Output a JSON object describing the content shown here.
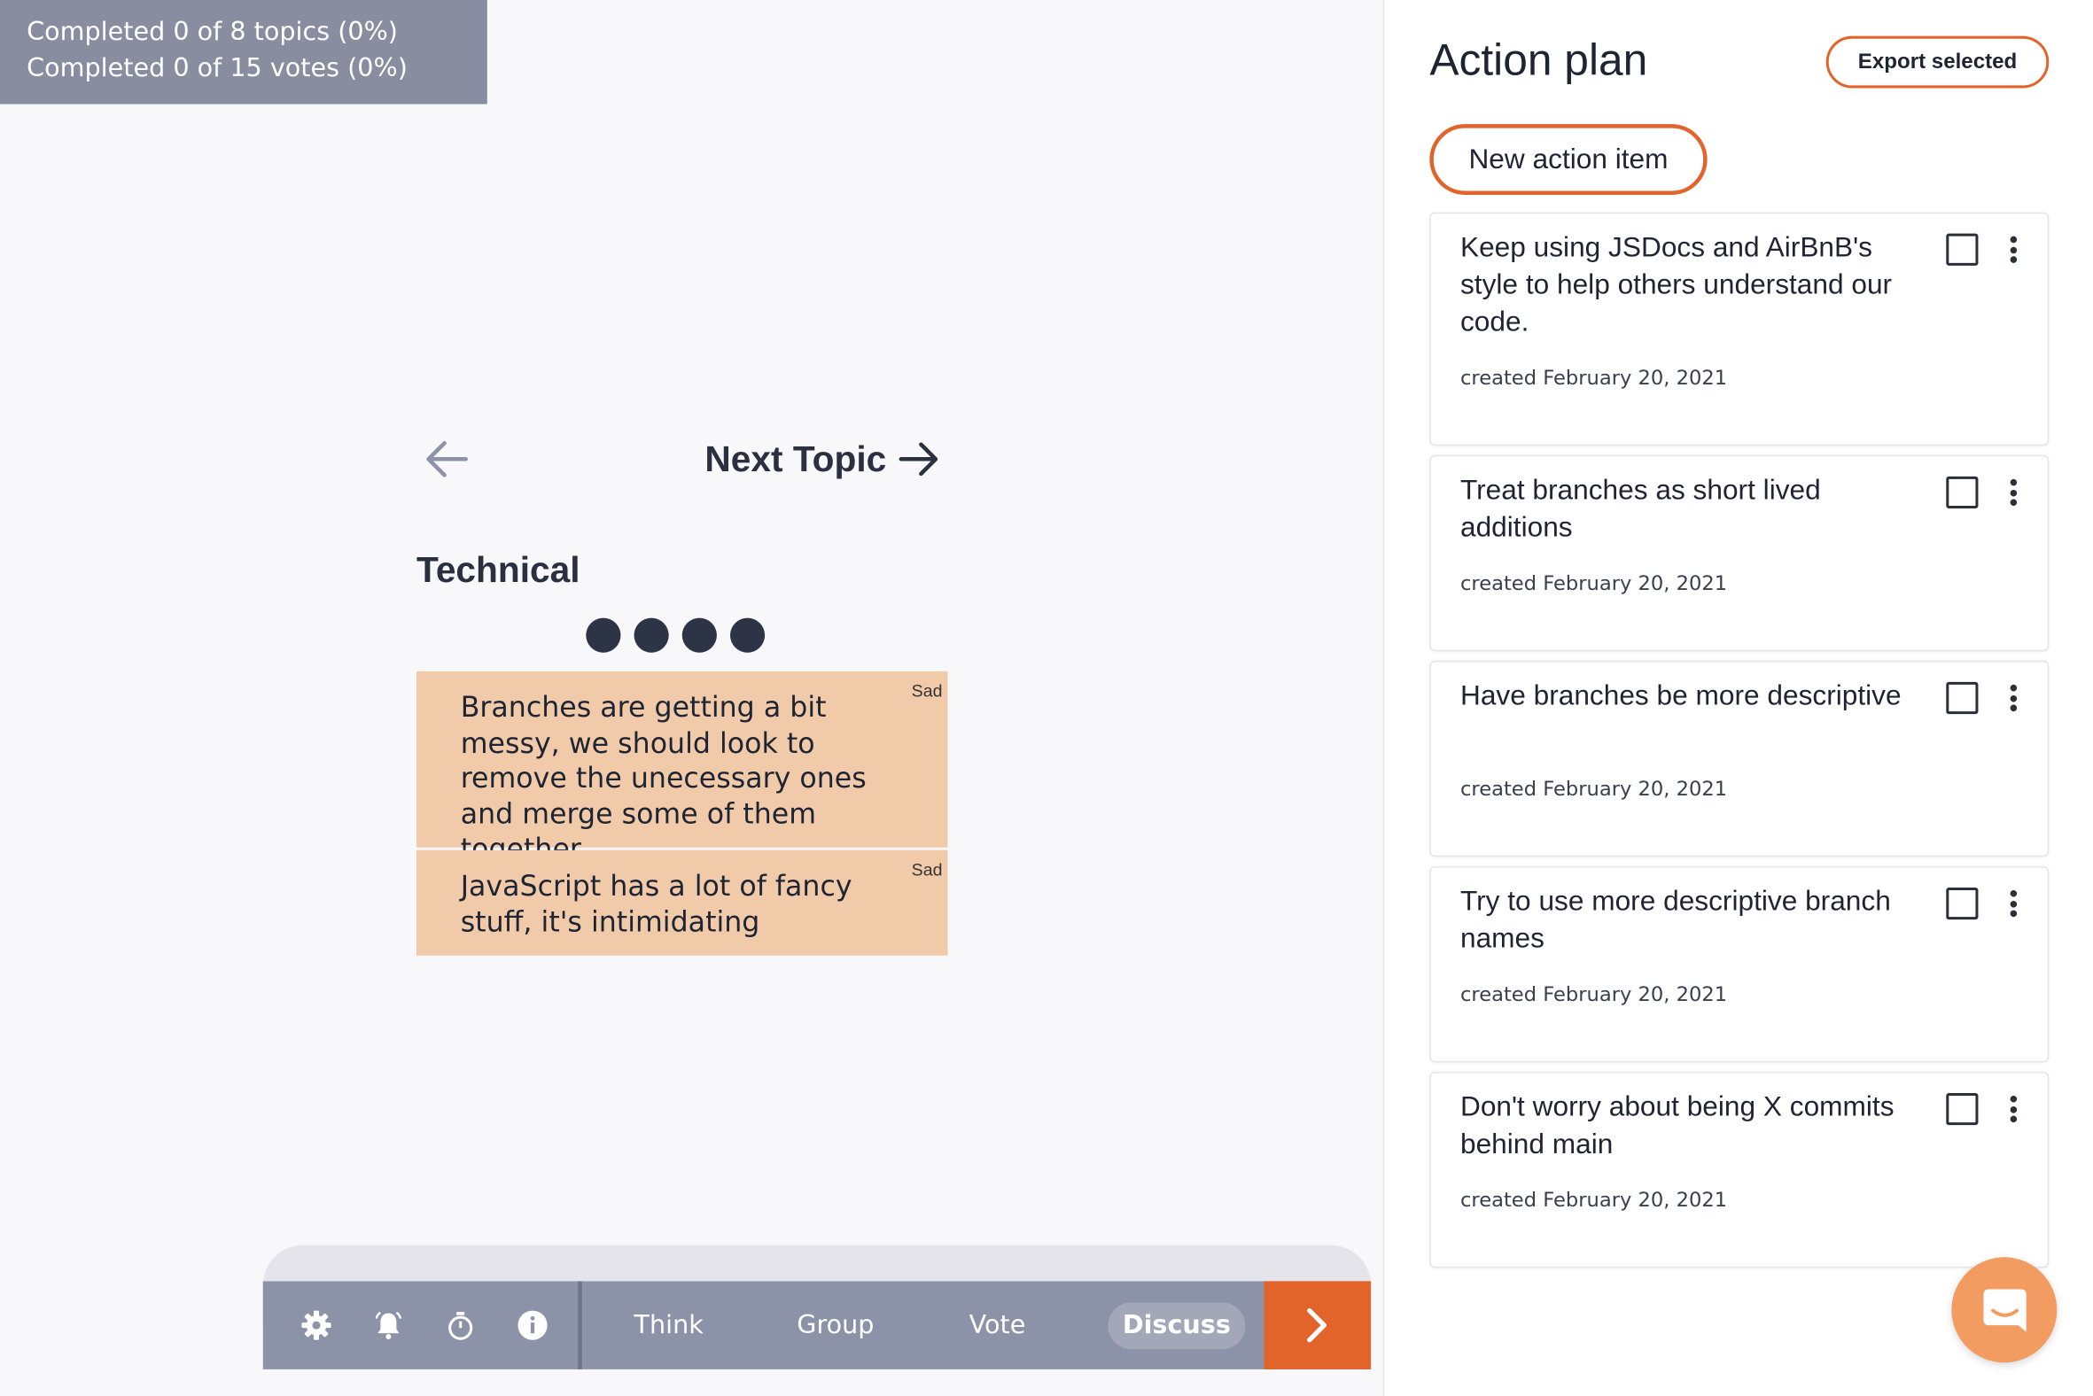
{
  "progress": {
    "topics": "Completed 0 of 8 topics (0%)",
    "votes": "Completed 0 of 15 votes (0%)"
  },
  "board": {
    "next_topic_label": "Next Topic",
    "topic_title": "Technical",
    "vote_count": 4,
    "cards": [
      {
        "tag": "Sad",
        "text": "Branches are getting a bit messy, we should look to remove the unecessary ones and merge some of them together"
      },
      {
        "tag": "Sad",
        "text": "JavaScript has a lot of fancy stuff, it's intimidating"
      }
    ]
  },
  "toolbar": {
    "icons": [
      "gear-icon",
      "bell-icon",
      "stopwatch-icon",
      "info-icon"
    ],
    "steps": [
      "Think",
      "Group",
      "Vote",
      "Discuss"
    ],
    "active_step": "Discuss",
    "accent_color": "#e2642a"
  },
  "action_plan": {
    "title": "Action plan",
    "export_label": "Export selected",
    "new_item_label": "New action item",
    "items": [
      {
        "text": "Keep using JSDocs and AirBnB's style to help others understand our code.",
        "date": "created February 20, 2021"
      },
      {
        "text": "Treat branches as short lived additions",
        "date": "created February 20, 2021"
      },
      {
        "text": "Have branches be more descriptive",
        "date": "created February 20, 2021"
      },
      {
        "text": "Try to use more descriptive branch names",
        "date": "created February 20, 2021"
      },
      {
        "text": "Don't worry about being X commits behind main",
        "date": "created February 20, 2021"
      }
    ]
  },
  "colors": {
    "card": "#f1cba9",
    "toolbar": "#8c93a8",
    "accent": "#e2642a",
    "progress_bg": "#888d9f"
  }
}
